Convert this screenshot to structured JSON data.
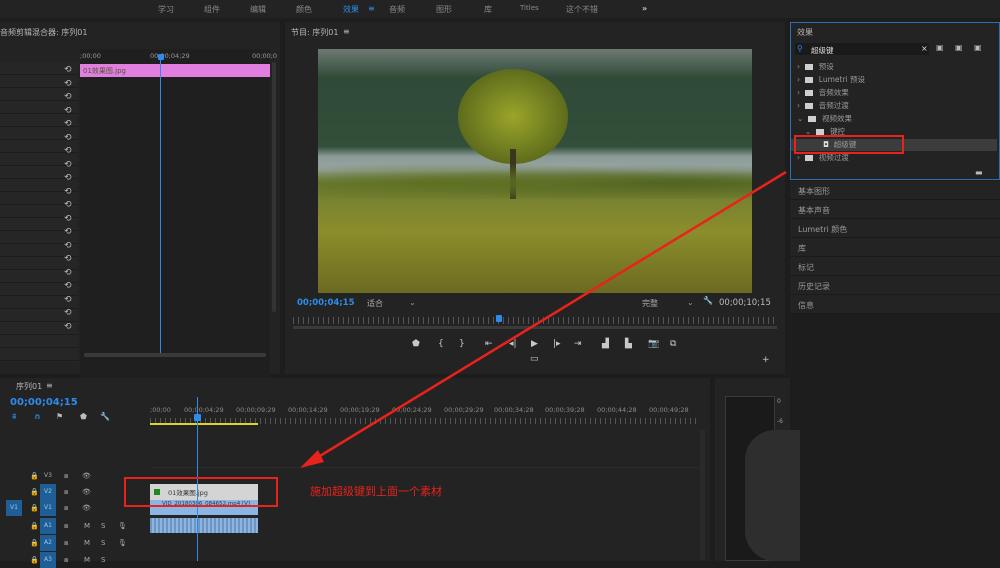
{
  "workspaces": [
    "学习",
    "组件",
    "编辑",
    "颜色",
    "效果",
    "音频",
    "图形",
    "库",
    "Titles",
    "这个不错"
  ],
  "active_workspace": "效果",
  "more_icon": "»",
  "left_panel": {
    "title": "音频剪辑混合器: 序列01",
    "ruler": [
      ";00;00",
      "00;00;04;29",
      "00;00;0"
    ],
    "clip": "01效果图.jpg"
  },
  "program": {
    "title": "节目: 序列01",
    "timecode": "00;00;04;15",
    "zoom": "适合",
    "quality": "完整",
    "duration": "00;00;10;15",
    "playhead_fraction": 0.43
  },
  "effects": {
    "title": "效果",
    "search": "超级键",
    "tree": [
      {
        "label": "预设",
        "level": 0
      },
      {
        "label": "Lumetri 预设",
        "level": 0
      },
      {
        "label": "音频效果",
        "level": 0
      },
      {
        "label": "音频过渡",
        "level": 0
      },
      {
        "label": "视频效果",
        "level": 0,
        "open": true
      },
      {
        "label": "键控",
        "level": 1,
        "open": true
      },
      {
        "label": "超级键",
        "level": 2,
        "selected": true
      },
      {
        "label": "视频过渡",
        "level": 0
      }
    ]
  },
  "side_panels": [
    "基本图形",
    "基本声音",
    "Lumetri 颜色",
    "库",
    "标记",
    "历史记录",
    "信息"
  ],
  "timeline": {
    "title": "序列01",
    "timecode": "00;00;04;15",
    "ruler": [
      ";00;00",
      "00;00;04;29",
      "00;00;09;29",
      "00;00;14;29",
      "00;00;19;29",
      "00;00;24;29",
      "00;00;29;29",
      "00;00;34;28",
      "00;00;39;28",
      "00;00;44;28",
      "00;00;49;28"
    ],
    "tracks": [
      "V3",
      "V2",
      "V1",
      "A1",
      "A2",
      "A3"
    ],
    "source_patch": "V1",
    "clip_v2": "01效果图.jpg",
    "clip_v1": "VID_20180306_084652.mp4 [V]"
  },
  "meter": {
    "labels": [
      "0",
      "-6"
    ]
  },
  "annotation": {
    "text": "施加超级键到上面一个素材",
    "color": "#e8231b"
  },
  "colors": {
    "accent": "#2d8ceb",
    "clip_pink": "#e07fe0",
    "clip_blue": "#8db5e3"
  }
}
